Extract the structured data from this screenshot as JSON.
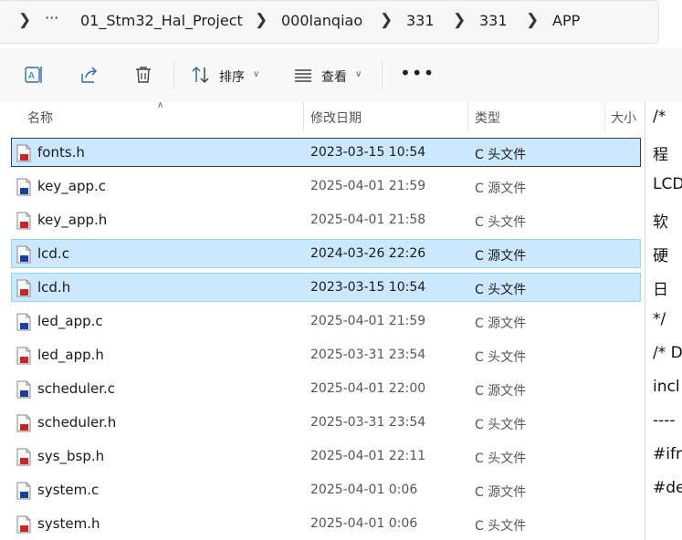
{
  "breadcrumb": {
    "more": "···",
    "items": [
      "01_Stm32_Hal_Project",
      "000lanqiao",
      "331",
      "331",
      "APP"
    ]
  },
  "toolbar": {
    "sort_label": "排序",
    "view_label": "查看",
    "more_label": "•••"
  },
  "columns": {
    "name": "名称",
    "modified": "修改日期",
    "type": "类型",
    "size": "大小"
  },
  "files": [
    {
      "name": "fonts.h",
      "modified": "2023-03-15 10:54",
      "type": "C 头文件",
      "kind": "h",
      "selected": true,
      "focused": true
    },
    {
      "name": "key_app.c",
      "modified": "2025-04-01 21:59",
      "type": "C 源文件",
      "kind": "c",
      "selected": false,
      "focused": false
    },
    {
      "name": "key_app.h",
      "modified": "2025-04-01 21:58",
      "type": "C 头文件",
      "kind": "h",
      "selected": false,
      "focused": false
    },
    {
      "name": "lcd.c",
      "modified": "2024-03-26 22:26",
      "type": "C 源文件",
      "kind": "c",
      "selected": true,
      "focused": false
    },
    {
      "name": "lcd.h",
      "modified": "2023-03-15 10:54",
      "type": "C 头文件",
      "kind": "h",
      "selected": true,
      "focused": false
    },
    {
      "name": "led_app.c",
      "modified": "2025-04-01 21:59",
      "type": "C 源文件",
      "kind": "c",
      "selected": false,
      "focused": false
    },
    {
      "name": "led_app.h",
      "modified": "2025-03-31 23:54",
      "type": "C 头文件",
      "kind": "h",
      "selected": false,
      "focused": false
    },
    {
      "name": "scheduler.c",
      "modified": "2025-04-01 22:00",
      "type": "C 源文件",
      "kind": "c",
      "selected": false,
      "focused": false
    },
    {
      "name": "scheduler.h",
      "modified": "2025-03-31 23:54",
      "type": "C 头文件",
      "kind": "h",
      "selected": false,
      "focused": false
    },
    {
      "name": "sys_bsp.h",
      "modified": "2025-04-01 22:11",
      "type": "C 头文件",
      "kind": "h",
      "selected": false,
      "focused": false
    },
    {
      "name": "system.c",
      "modified": "2025-04-01 0:06",
      "type": "C 源文件",
      "kind": "c",
      "selected": false,
      "focused": false
    },
    {
      "name": "system.h",
      "modified": "2025-04-01 0:06",
      "type": "C 头文件",
      "kind": "h",
      "selected": false,
      "focused": false
    }
  ],
  "code_pane": {
    "lines": [
      "/*",
      "  程",
      "LCD",
      "  软",
      "  硬",
      "  日",
      "*/",
      "/* D",
      "incl",
      "----",
      "#ifr",
      "#de"
    ]
  },
  "colors": {
    "selection_bg": "#cce8ff",
    "selection_border": "#99d1ff",
    "h_icon": "#c62828",
    "c_icon": "#1a3fa0"
  }
}
